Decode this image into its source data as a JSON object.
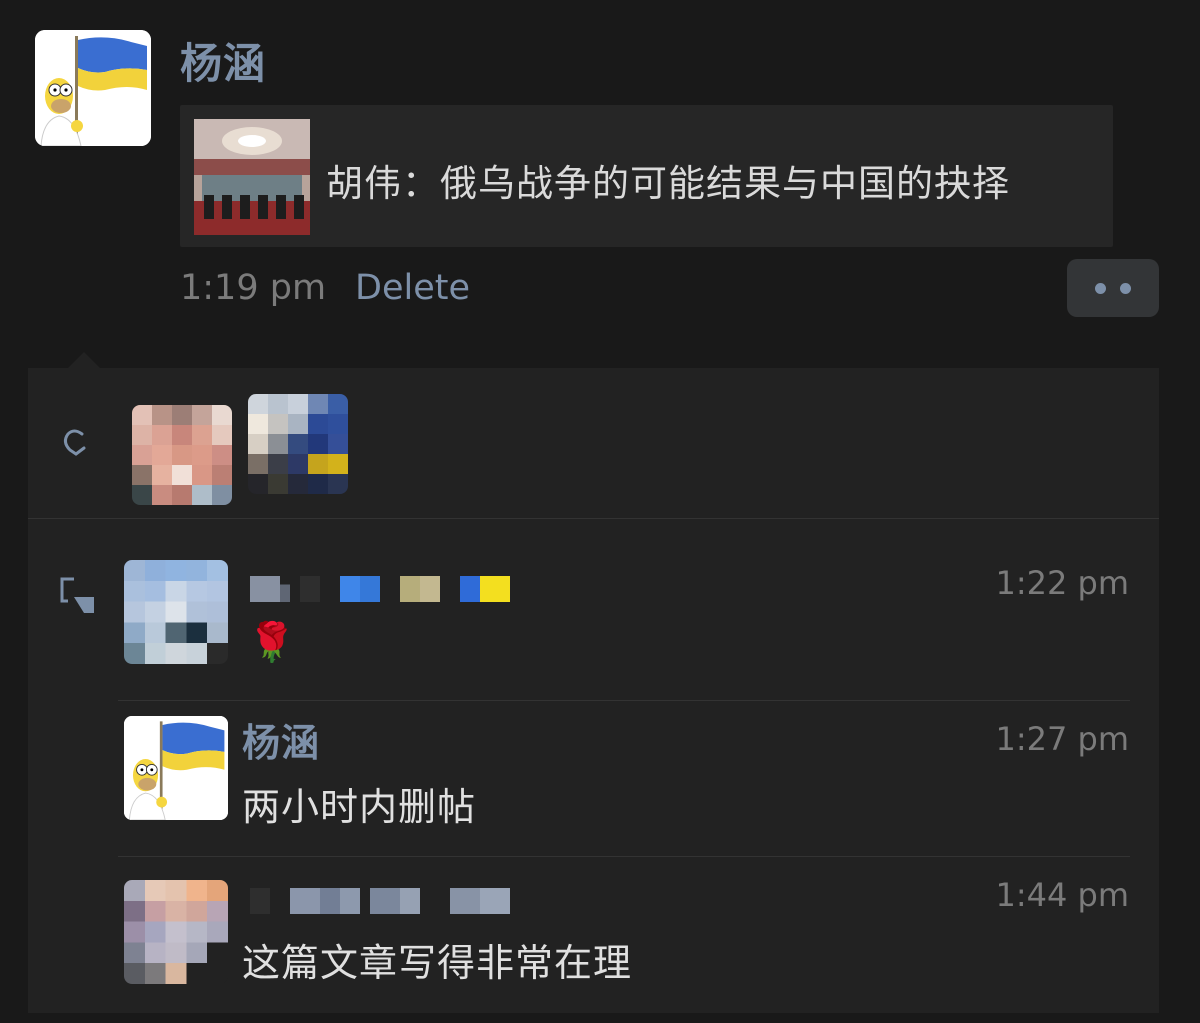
{
  "post": {
    "author": "杨涵",
    "link_title": "胡伟：俄乌战争的可能结果与中国的抉择",
    "time": "1:19 pm",
    "delete_label": "Delete"
  },
  "likes": {
    "icon": "heart-icon",
    "avatar_count": 2
  },
  "comments": [
    {
      "author": "",
      "text": "🌹",
      "time": "1:22 pm"
    },
    {
      "author": "杨涵",
      "text": "两小时内删帖",
      "time": "1:27 pm"
    },
    {
      "author": "",
      "text": "这篇文章写得非常在理",
      "time": "1:44 pm"
    }
  ],
  "colors": {
    "background": "#191919",
    "panel": "#222222",
    "name_link": "#7d90a9",
    "timestamp": "#7b7b7b"
  }
}
